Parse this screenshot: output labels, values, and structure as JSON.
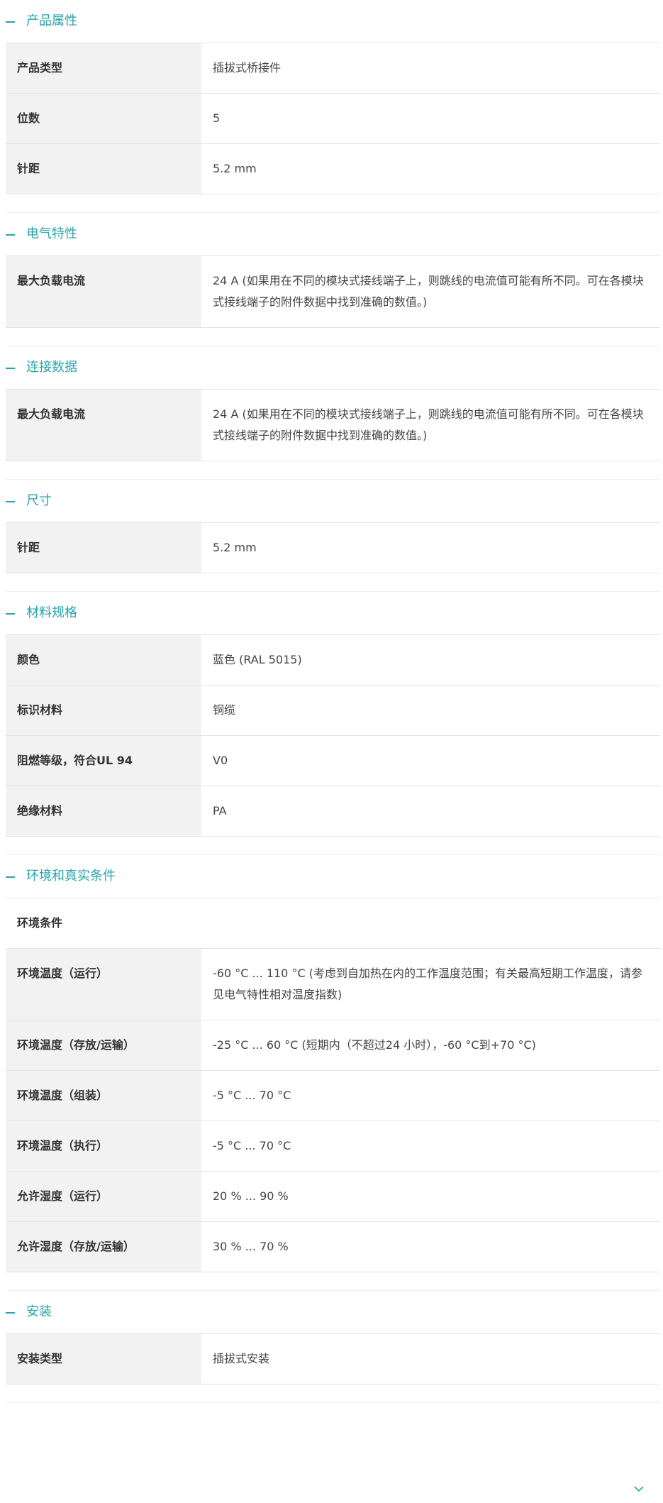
{
  "sections": [
    {
      "title": "产品属性",
      "rows": [
        {
          "label": "产品类型",
          "value": "插拔式桥接件"
        },
        {
          "label": "位数",
          "value": "5"
        },
        {
          "label": "针距",
          "value": "5.2 mm"
        }
      ]
    },
    {
      "title": "电气特性",
      "rows": [
        {
          "label": "最大负载电流",
          "value": "24 A (如果用在不同的模块式接线端子上，则跳线的电流值可能有所不同。可在各模块式接线端子的附件数据中找到准确的数值。)"
        }
      ]
    },
    {
      "title": "连接数据",
      "rows": [
        {
          "label": "最大负载电流",
          "value": "24 A (如果用在不同的模块式接线端子上，则跳线的电流值可能有所不同。可在各模块式接线端子的附件数据中找到准确的数值。)"
        }
      ]
    },
    {
      "title": "尺寸",
      "rows": [
        {
          "label": "针距",
          "value": "5.2 mm"
        }
      ]
    },
    {
      "title": "材料规格",
      "rows": [
        {
          "label": "颜色",
          "value": "蓝色 (RAL 5015)"
        },
        {
          "label": "标识材料",
          "value": "铜缆"
        },
        {
          "label": "阻燃等级，符合UL 94",
          "value": "V0"
        },
        {
          "label": "绝缘材料",
          "value": "PA"
        }
      ]
    },
    {
      "title": "环境和真实条件",
      "subheading": "环境条件",
      "rows": [
        {
          "label": "环境温度（运行）",
          "value": "-60 °C ... 110 °C (考虑到自加热在内的工作温度范围；有关最高短期工作温度，请参见电气特性相对温度指数)"
        },
        {
          "label": "环境温度（存放/运输）",
          "value": "-25 °C ... 60 °C (短期内（不超过24 小时），-60 °C到+70 °C)"
        },
        {
          "label": "环境温度（组装）",
          "value": "-5 °C ... 70 °C"
        },
        {
          "label": "环境温度（执行）",
          "value": "-5 °C ... 70 °C"
        },
        {
          "label": "允许湿度（运行）",
          "value": "20 % ... 90 %"
        },
        {
          "label": "允许湿度（存放/运输）",
          "value": "30 % ... 70 %"
        }
      ]
    },
    {
      "title": "安装",
      "rows": [
        {
          "label": "安装类型",
          "value": "插拔式安装"
        }
      ]
    }
  ],
  "icons": {
    "section_toggle": "minus-icon",
    "scroll_more": "chevron-down-icon"
  },
  "colors": {
    "accent": "#2aa3ae",
    "label_bg": "#f2f2f2",
    "border": "#e4e4e4"
  }
}
